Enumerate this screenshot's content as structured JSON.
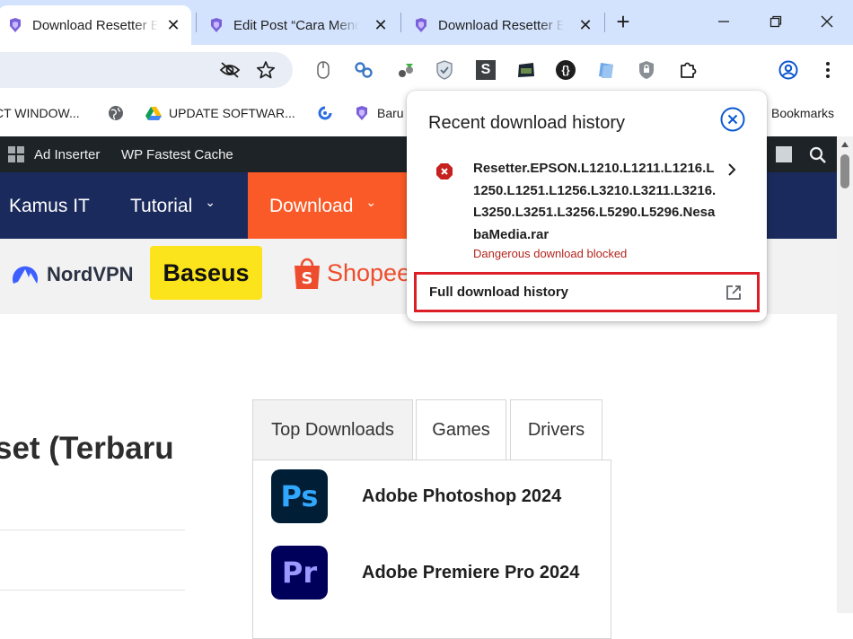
{
  "tabs": [
    {
      "title": "Download Resetter E",
      "active": true,
      "close": "✕"
    },
    {
      "title": "Edit Post “Cara Meno",
      "active": false,
      "close": "✕"
    },
    {
      "title": "Download Resetter E",
      "active": false,
      "close": "✕"
    }
  ],
  "tabstrip": {
    "new_tab": "+"
  },
  "bookmarks": {
    "items": [
      "CT WINDOW...",
      "",
      "UPDATE SOFTWAR...",
      "",
      "Baru"
    ],
    "all_bookmarks": "Bookmarks"
  },
  "page": {
    "wp_admin_bar": [
      "Ad Inserter",
      "WP Fastest Cache"
    ],
    "nav": [
      {
        "label": "Kamus IT",
        "chevron": ""
      },
      {
        "label": "Tutorial",
        "chevron": "⌄"
      },
      {
        "label": "Download",
        "chevron": "⌄"
      }
    ],
    "sponsors": [
      "NordVPN",
      "Baseus",
      "Shopee"
    ],
    "heading": "set (Terbaru",
    "download_tabs": [
      "Top Downloads",
      "Games",
      "Drivers"
    ],
    "top_downloads": [
      {
        "icon_text": "Ps",
        "name": "Adobe Photoshop 2024"
      },
      {
        "icon_text": "Pr",
        "name": "Adobe Premiere Pro 2024"
      }
    ]
  },
  "download_bubble": {
    "title": "Recent download history",
    "item": {
      "filename": "Resetter.EPSON.L1210.L1211.L1216.L1250.L1251.L1256.L3210.L3211.L3216.L3250.L3251.L3256.L5290.L5296.NesabaMedia.rar",
      "status": "Dangerous download blocked"
    },
    "full_history_label": "Full download history"
  },
  "colors": {
    "tabstrip_bg": "#d3e3fd",
    "nav_bg": "#1b2a5c",
    "nav_active_bg": "#fa5a27",
    "danger": "#b3261e",
    "highlight_box": "#dc1f26",
    "accent_blue": "#0b57d0"
  }
}
